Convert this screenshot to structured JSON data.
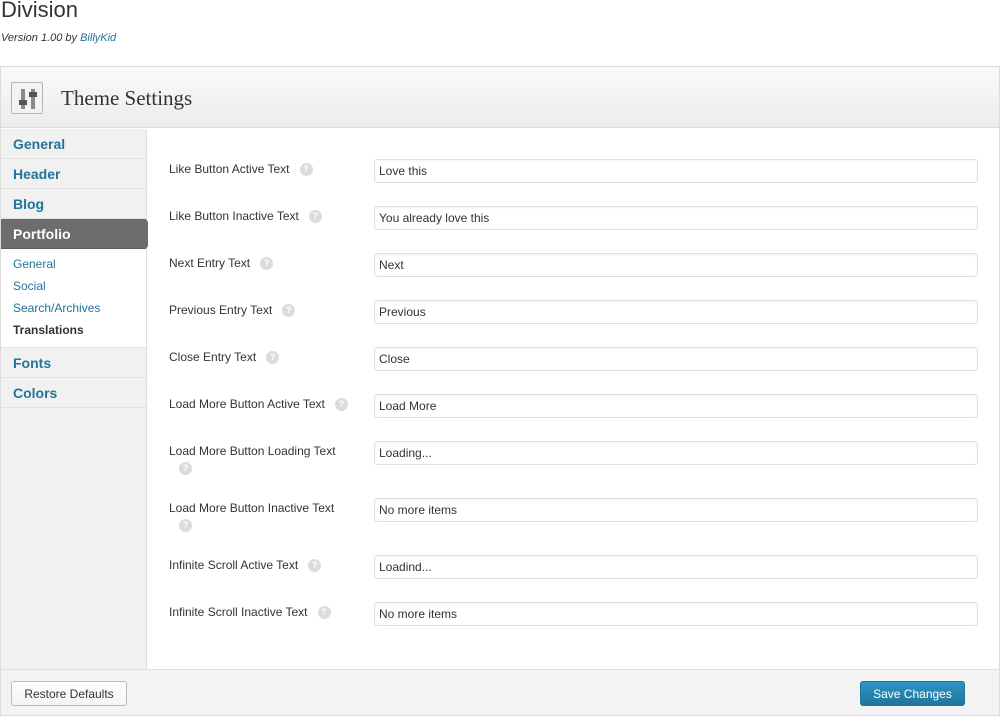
{
  "theme": {
    "name": "Division",
    "version_prefix": "Version 1.00 by ",
    "author": "BillyKid"
  },
  "header": {
    "title": "Theme Settings",
    "icon": "sliders-icon"
  },
  "sidebar": {
    "items_top": [
      {
        "label": "General"
      },
      {
        "label": "Header"
      },
      {
        "label": "Blog"
      },
      {
        "label": "Portfolio"
      }
    ],
    "submenu": [
      {
        "label": "General"
      },
      {
        "label": "Social"
      },
      {
        "label": "Search/Archives"
      },
      {
        "label": "Translations"
      }
    ],
    "items_bottom": [
      {
        "label": "Fonts"
      },
      {
        "label": "Colors"
      }
    ]
  },
  "fields": [
    {
      "label": "Like Button Active Text",
      "value": "Love this"
    },
    {
      "label": "Like Button Inactive Text",
      "value": "You already love this"
    },
    {
      "label": "Next Entry Text",
      "value": "Next"
    },
    {
      "label": "Previous Entry Text",
      "value": "Previous"
    },
    {
      "label": "Close Entry Text",
      "value": "Close"
    },
    {
      "label": "Load More Button Active Text",
      "value": "Load More"
    },
    {
      "label": "Load More Button Loading Text",
      "value": "Loading..."
    },
    {
      "label": "Load More Button Inactive Text",
      "value": "No more items"
    },
    {
      "label": "Infinite Scroll Active Text",
      "value": "Loadind..."
    },
    {
      "label": "Infinite Scroll Inactive Text",
      "value": "No more items"
    }
  ],
  "help_glyph": "?",
  "footer": {
    "restore_label": "Restore Defaults",
    "save_label": "Save Changes"
  },
  "colors": {
    "link": "#21759b",
    "active_nav": "#6d6d6d",
    "primary_button": "#21759b"
  }
}
